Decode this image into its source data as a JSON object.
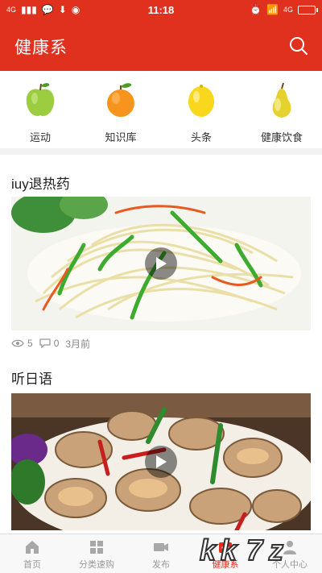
{
  "status_bar": {
    "left_text": "4G",
    "time": "11:18",
    "right_text": "4G"
  },
  "header": {
    "title": "健康系",
    "search_icon": "search-icon"
  },
  "categories": [
    {
      "label": "运动",
      "icon": "green-apple-icon",
      "color": "#8cc63f"
    },
    {
      "label": "知识库",
      "icon": "orange-icon",
      "color": "#f7941d"
    },
    {
      "label": "头条",
      "icon": "lemon-icon",
      "color": "#f9d71c"
    },
    {
      "label": "健康饮食",
      "icon": "pear-icon",
      "color": "#e6d22e"
    }
  ],
  "posts": [
    {
      "title": "iuy退热药",
      "views": "5",
      "comments": "0",
      "time": "3月前"
    },
    {
      "title": "听日语"
    }
  ],
  "tabs": [
    {
      "label": "首页",
      "icon": "home-icon"
    },
    {
      "label": "分类速购",
      "icon": "grid-icon"
    },
    {
      "label": "发布",
      "icon": "video-icon"
    },
    {
      "label": "健康系",
      "icon": "health-icon",
      "active": true
    },
    {
      "label": "个人中心",
      "icon": "person-icon"
    }
  ],
  "colors": {
    "brand": "#e0301e",
    "tab_inactive": "#9a9a9a"
  },
  "watermark": "k k 7"
}
